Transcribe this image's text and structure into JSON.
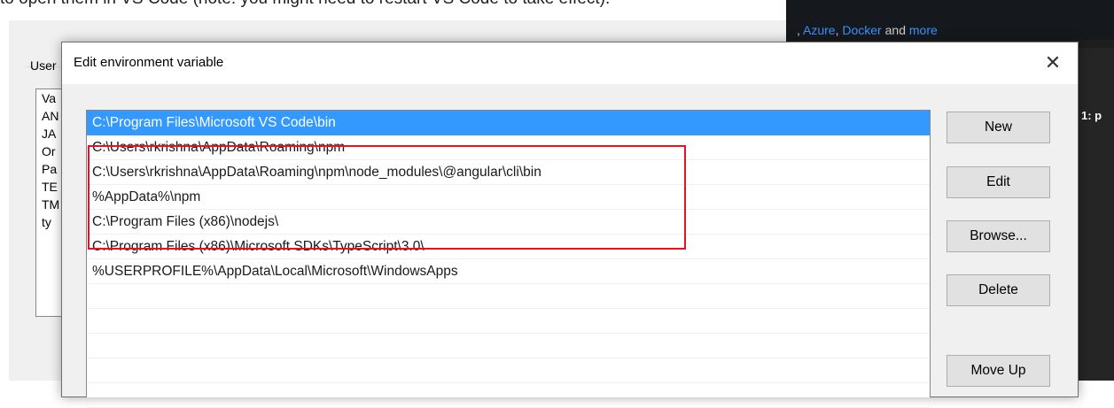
{
  "background_text": "to open them in VS Code (note: you might need to restart VS Code to take effect).",
  "vscode": {
    "links_sep": ", ",
    "link_azure": "Azure",
    "link_docker": "Docker",
    "and_text": " and ",
    "link_more": "more",
    "tab_label": "1: p"
  },
  "parent_dialog": {
    "group_label": "User",
    "list_items": [
      "Va",
      "AN",
      "JA",
      "Or",
      "Pa",
      "TE",
      "TM",
      "ty"
    ]
  },
  "dialog": {
    "title": "Edit environment variable",
    "close_glyph": "✕",
    "paths": [
      "C:\\Program Files\\Microsoft VS Code\\bin",
      "C:\\Users\\rkrishna\\AppData\\Roaming\\npm",
      "C:\\Users\\rkrishna\\AppData\\Roaming\\npm\\node_modules\\@angular\\cli\\bin",
      "%AppData%\\npm",
      "C:\\Program Files (x86)\\nodejs\\",
      "C:\\Program Files (x86)\\Microsoft SDKs\\TypeScript\\3.0\\",
      "%USERPROFILE%\\AppData\\Local\\Microsoft\\WindowsApps",
      "",
      "",
      "",
      "",
      ""
    ],
    "selected_index": 0,
    "buttons": {
      "new": "New",
      "edit": "Edit",
      "browse": "Browse...",
      "delete": "Delete",
      "move_up": "Move Up"
    }
  },
  "colors": {
    "selection": "#3399ff",
    "highlight_box": "#e81123",
    "link": "#3794ff"
  }
}
